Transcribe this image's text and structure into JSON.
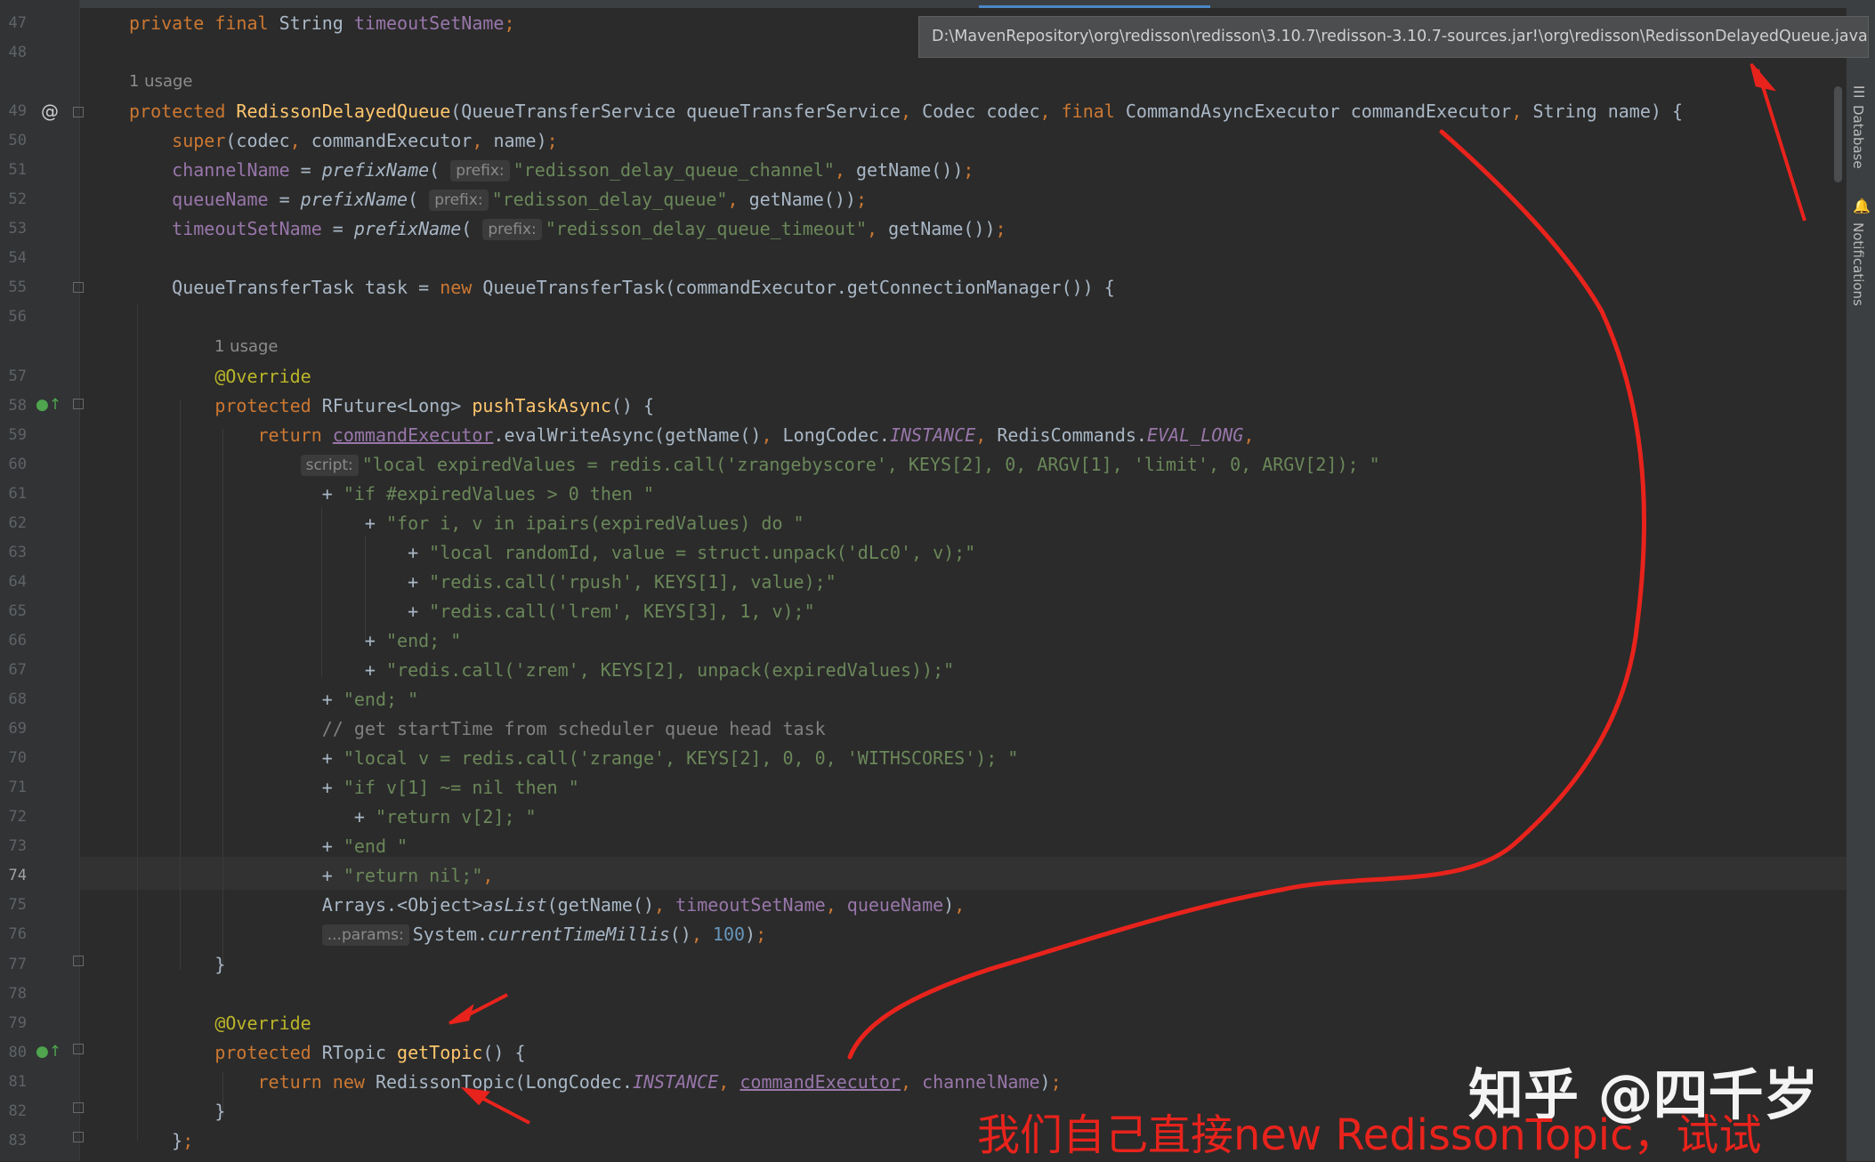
{
  "tooltip": {
    "path": "D:\\MavenRepository\\org\\redisson\\redisson\\3.10.7\\redisson-3.10.7-sources.jar!\\org\\redisson\\RedissonDelayedQueue.java"
  },
  "right_panel": {
    "database": "Database",
    "notifications": "Notifications"
  },
  "overlay": {
    "watermark": "知乎 @四千岁",
    "caption": "我们自己直接new RedissonTopic，试试"
  },
  "colors": {
    "annotation_red": "#e8231c",
    "background": "#2b2b2b",
    "keyword": "#cc7832",
    "string": "#6a8759"
  },
  "editor": {
    "current_line": "74",
    "lines": [
      {
        "n": "47",
        "t": [
          {
            "c": "kw",
            "s": "private final "
          },
          {
            "c": "",
            "s": "String "
          },
          {
            "c": "fld",
            "s": "timeoutSetName"
          },
          {
            "c": "kw",
            "s": ";"
          }
        ]
      },
      {
        "n": "48",
        "t": []
      },
      {
        "n": "49",
        "usage": "1 usage",
        "t": [
          {
            "c": "kw",
            "s": "protected "
          },
          {
            "c": "fn",
            "s": "RedissonDelayedQueue"
          },
          {
            "c": "",
            "s": "(QueueTransferService queueTransferService"
          },
          {
            "c": "kw",
            "s": ", "
          },
          {
            "c": "",
            "s": "Codec codec"
          },
          {
            "c": "kw",
            "s": ", final "
          },
          {
            "c": "",
            "s": "CommandAsyncExecutor commandExecutor"
          },
          {
            "c": "kw",
            "s": ", "
          },
          {
            "c": "",
            "s": "String name) {"
          }
        ]
      },
      {
        "n": "50",
        "t": [
          {
            "c": "kw",
            "s": "    super"
          },
          {
            "c": "",
            "s": "(codec"
          },
          {
            "c": "kw",
            "s": ", "
          },
          {
            "c": "",
            "s": "commandExecutor"
          },
          {
            "c": "kw",
            "s": ", "
          },
          {
            "c": "",
            "s": "name)"
          },
          {
            "c": "kw",
            "s": ";"
          }
        ]
      },
      {
        "n": "51",
        "t": [
          {
            "c": "fld",
            "s": "    channelName"
          },
          {
            "c": "",
            "s": " = "
          },
          {
            "c": "it",
            "s": "prefixName"
          },
          {
            "c": "",
            "s": "( "
          },
          {
            "c": "hint",
            "s": "prefix:"
          },
          {
            "c": "str",
            "s": "\"redisson_delay_queue_channel\""
          },
          {
            "c": "kw",
            "s": ", "
          },
          {
            "c": "",
            "s": "getName())"
          },
          {
            "c": "kw",
            "s": ";"
          }
        ]
      },
      {
        "n": "52",
        "t": [
          {
            "c": "fld",
            "s": "    queueName"
          },
          {
            "c": "",
            "s": " = "
          },
          {
            "c": "it",
            "s": "prefixName"
          },
          {
            "c": "",
            "s": "( "
          },
          {
            "c": "hint",
            "s": "prefix:"
          },
          {
            "c": "str",
            "s": "\"redisson_delay_queue\""
          },
          {
            "c": "kw",
            "s": ", "
          },
          {
            "c": "",
            "s": "getName())"
          },
          {
            "c": "kw",
            "s": ";"
          }
        ]
      },
      {
        "n": "53",
        "t": [
          {
            "c": "fld",
            "s": "    timeoutSetName"
          },
          {
            "c": "",
            "s": " = "
          },
          {
            "c": "it",
            "s": "prefixName"
          },
          {
            "c": "",
            "s": "( "
          },
          {
            "c": "hint",
            "s": "prefix:"
          },
          {
            "c": "str",
            "s": "\"redisson_delay_queue_timeout\""
          },
          {
            "c": "kw",
            "s": ", "
          },
          {
            "c": "",
            "s": "getName())"
          },
          {
            "c": "kw",
            "s": ";"
          }
        ]
      },
      {
        "n": "54",
        "t": []
      },
      {
        "n": "55",
        "t": [
          {
            "c": "",
            "s": "    QueueTransferTask task = "
          },
          {
            "c": "kw",
            "s": "new "
          },
          {
            "c": "",
            "s": "QueueTransferTask(commandExecutor.getConnectionManager()) {"
          }
        ]
      },
      {
        "n": "56",
        "t": []
      },
      {
        "n": "57",
        "usage": "1 usage",
        "t": [
          {
            "c": "ann",
            "s": "        @Override"
          }
        ]
      },
      {
        "n": "58",
        "t": [
          {
            "c": "kw",
            "s": "        protected "
          },
          {
            "c": "",
            "s": "RFuture<Long> "
          },
          {
            "c": "fn",
            "s": "pushTaskAsync"
          },
          {
            "c": "",
            "s": "() {"
          }
        ]
      },
      {
        "n": "59",
        "t": [
          {
            "c": "kw",
            "s": "            return "
          },
          {
            "c": "fld ul",
            "s": "commandExecutor"
          },
          {
            "c": "",
            "s": ".evalWriteAsync(getName()"
          },
          {
            "c": "kw",
            "s": ", "
          },
          {
            "c": "",
            "s": "LongCodec."
          },
          {
            "c": "fld it",
            "s": "INSTANCE"
          },
          {
            "c": "kw",
            "s": ", "
          },
          {
            "c": "",
            "s": "RedisCommands."
          },
          {
            "c": "fld it",
            "s": "EVAL_LONG"
          },
          {
            "c": "kw",
            "s": ","
          }
        ]
      },
      {
        "n": "60",
        "t": [
          {
            "c": "",
            "s": "                "
          },
          {
            "c": "hint",
            "s": "script:"
          },
          {
            "c": "str",
            "s": "\"local expiredValues = redis.call('zrangebyscore', KEYS[2], 0, ARGV[1], 'limit', 0, ARGV[2]); \""
          }
        ]
      },
      {
        "n": "61",
        "t": [
          {
            "c": "",
            "s": "                  + "
          },
          {
            "c": "str",
            "s": "\"if #expiredValues > 0 then \""
          }
        ]
      },
      {
        "n": "62",
        "t": [
          {
            "c": "",
            "s": "                      + "
          },
          {
            "c": "str",
            "s": "\"for i, v in ipairs(expiredValues) do \""
          }
        ]
      },
      {
        "n": "63",
        "t": [
          {
            "c": "",
            "s": "                          + "
          },
          {
            "c": "str",
            "s": "\"local randomId, value = struct.unpack('dLc0', v);\""
          }
        ]
      },
      {
        "n": "64",
        "t": [
          {
            "c": "",
            "s": "                          + "
          },
          {
            "c": "str",
            "s": "\"redis.call('rpush', KEYS[1], value);\""
          }
        ]
      },
      {
        "n": "65",
        "t": [
          {
            "c": "",
            "s": "                          + "
          },
          {
            "c": "str",
            "s": "\"redis.call('lrem', KEYS[3], 1, v);\""
          }
        ]
      },
      {
        "n": "66",
        "t": [
          {
            "c": "",
            "s": "                      + "
          },
          {
            "c": "str",
            "s": "\"end; \""
          }
        ]
      },
      {
        "n": "67",
        "t": [
          {
            "c": "",
            "s": "                      + "
          },
          {
            "c": "str",
            "s": "\"redis.call('zrem', KEYS[2], unpack(expiredValues));\""
          }
        ]
      },
      {
        "n": "68",
        "t": [
          {
            "c": "",
            "s": "                  + "
          },
          {
            "c": "str",
            "s": "\"end; \""
          }
        ]
      },
      {
        "n": "69",
        "t": [
          {
            "c": "cmt",
            "s": "                  // get startTime from scheduler queue head task"
          }
        ]
      },
      {
        "n": "70",
        "t": [
          {
            "c": "",
            "s": "                  + "
          },
          {
            "c": "str",
            "s": "\"local v = redis.call('zrange', KEYS[2], 0, 0, 'WITHSCORES'); \""
          }
        ]
      },
      {
        "n": "71",
        "t": [
          {
            "c": "",
            "s": "                  + "
          },
          {
            "c": "str",
            "s": "\"if v[1] ~= nil then \""
          }
        ]
      },
      {
        "n": "72",
        "t": [
          {
            "c": "",
            "s": "                     + "
          },
          {
            "c": "str",
            "s": "\"return v[2]; \""
          }
        ]
      },
      {
        "n": "73",
        "t": [
          {
            "c": "",
            "s": "                  + "
          },
          {
            "c": "str",
            "s": "\"end \""
          }
        ]
      },
      {
        "n": "74",
        "t": [
          {
            "c": "",
            "s": "                  + "
          },
          {
            "c": "str",
            "s": "\"return nil;\""
          },
          {
            "c": "kw",
            "s": ","
          }
        ]
      },
      {
        "n": "75",
        "t": [
          {
            "c": "",
            "s": "                  Arrays.<Object>"
          },
          {
            "c": "it",
            "s": "asList"
          },
          {
            "c": "",
            "s": "(getName()"
          },
          {
            "c": "kw",
            "s": ", "
          },
          {
            "c": "fld",
            "s": "timeoutSetName"
          },
          {
            "c": "kw",
            "s": ", "
          },
          {
            "c": "fld",
            "s": "queueName"
          },
          {
            "c": "",
            "s": ")"
          },
          {
            "c": "kw",
            "s": ","
          }
        ]
      },
      {
        "n": "76",
        "t": [
          {
            "c": "",
            "s": "                  "
          },
          {
            "c": "hint",
            "s": "...params:"
          },
          {
            "c": "",
            "s": "System."
          },
          {
            "c": "it",
            "s": "currentTimeMillis"
          },
          {
            "c": "",
            "s": "()"
          },
          {
            "c": "kw",
            "s": ", "
          },
          {
            "c": "num",
            "s": "100"
          },
          {
            "c": "",
            "s": ")"
          },
          {
            "c": "kw",
            "s": ";"
          }
        ]
      },
      {
        "n": "77",
        "t": [
          {
            "c": "",
            "s": "        }"
          }
        ]
      },
      {
        "n": "78",
        "t": []
      },
      {
        "n": "79",
        "t": [
          {
            "c": "ann",
            "s": "        @Override"
          }
        ]
      },
      {
        "n": "80",
        "t": [
          {
            "c": "kw",
            "s": "        protected "
          },
          {
            "c": "",
            "s": "RTopic "
          },
          {
            "c": "fn",
            "s": "getTopic"
          },
          {
            "c": "",
            "s": "() {"
          }
        ]
      },
      {
        "n": "81",
        "t": [
          {
            "c": "kw",
            "s": "            return new "
          },
          {
            "c": "",
            "s": "RedissonTopic(LongCodec."
          },
          {
            "c": "fld it",
            "s": "INSTANCE"
          },
          {
            "c": "kw",
            "s": ", "
          },
          {
            "c": "fld ul",
            "s": "commandExecutor"
          },
          {
            "c": "kw",
            "s": ", "
          },
          {
            "c": "fld",
            "s": "channelName"
          },
          {
            "c": "",
            "s": ")"
          },
          {
            "c": "kw",
            "s": ";"
          }
        ]
      },
      {
        "n": "82",
        "t": [
          {
            "c": "",
            "s": "        }"
          }
        ]
      },
      {
        "n": "83",
        "t": [
          {
            "c": "",
            "s": "    }"
          },
          {
            "c": "kw",
            "s": ";"
          }
        ]
      }
    ]
  }
}
